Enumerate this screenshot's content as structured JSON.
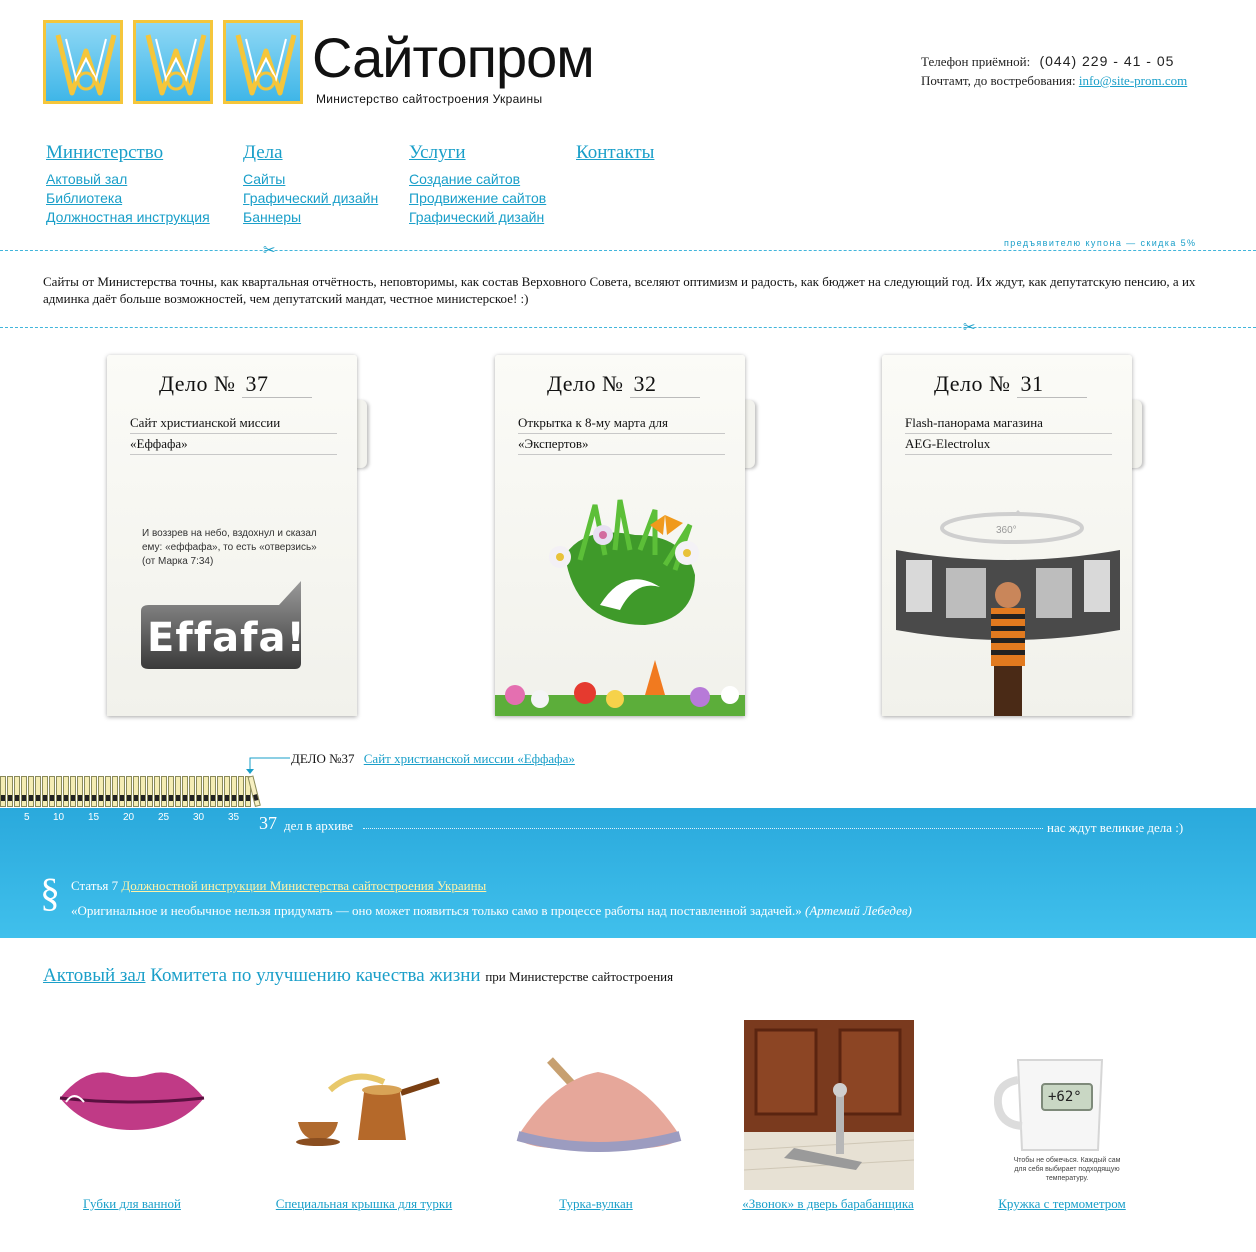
{
  "brand": {
    "title": "Сайтопром",
    "subtitle": "Министерство сайтостроения Украины"
  },
  "contact": {
    "phone_label": "Телефон приёмной:",
    "phone_value": "(044) 229 - 41 - 05",
    "mail_label": "Почтамт, до востребования:",
    "email": "info@site-prom.com"
  },
  "nav": [
    {
      "title": "Министерство",
      "items": [
        "Актовый зал",
        "Библиотека",
        "Должностная инструкция"
      ]
    },
    {
      "title": "Дела",
      "items": [
        "Сайты",
        "Графический дизайн",
        "Баннеры"
      ]
    },
    {
      "title": "Услуги",
      "items": [
        "Создание сайтов",
        "Продвижение сайтов",
        "Графический дизайн"
      ]
    },
    {
      "title": "Контакты",
      "items": []
    }
  ],
  "coupon": "предъявителю купона — скидка 5%",
  "intro": "Сайты от Министерства точны, как квартальная отчётность, неповторимы, как состав Верховного Совета, вселяют оптимизм и радость, как бюджет на следующий год. Их ждут, как депутатскую пенсию, а их админка даёт больше возможностей, чем депутатский мандат, честное министерское! :)",
  "cases": [
    {
      "label": "Дело №",
      "number": "37",
      "line1": "Сайт христианской миссии",
      "line2": "«Еффафа»",
      "quote": "И воззрев на небо, вздохнул и сказал ему: «еффафа», то есть «отверзись» (от Марка 7:34)",
      "logo": "Effafa!"
    },
    {
      "label": "Дело №",
      "number": "32",
      "line1": "Открытка к 8-му марта для",
      "line2": "«Экспертов»"
    },
    {
      "label": "Дело №",
      "number": "31",
      "line1": "Flash-панорама магазина",
      "line2": "AEG-Electrolux",
      "badge": "360°"
    }
  ],
  "archive": {
    "current_label": "ДЕЛО №37",
    "current_link": "Сайт христианской миссии «Еффафа»",
    "ticks": [
      "5",
      "10",
      "15",
      "20",
      "25",
      "30",
      "35"
    ],
    "count": "37",
    "count_text": "дел в архиве",
    "right_text": "нас ждут великие дела :)",
    "total_books": 37
  },
  "quote": {
    "symbol": "§",
    "article": "Статья 7",
    "link": "Должностной инструкции Министерства сайтостроения Украины",
    "text": "«Оригинальное и необычное нельзя придумать — оно может появиться только само в процессе работы над поставленной задачей.»",
    "author": "(Артемий Лебедев)"
  },
  "hall": {
    "link": "Актовый зал",
    "title": "Комитета по улучшению качества жизни",
    "suffix": "при Министерстве сайтостроения",
    "items": [
      {
        "label": "Губки для ванной"
      },
      {
        "label": "Специальная крышка для турки"
      },
      {
        "label": "Турка-вулкан"
      },
      {
        "label": "«Звонок» в дверь барабанщика"
      },
      {
        "label": "Кружка с термометром",
        "mug_display": "+62°",
        "mug_caption": "Чтобы не обжечься. Каждый сам для себя выбирает подходящую температуру."
      }
    ]
  }
}
